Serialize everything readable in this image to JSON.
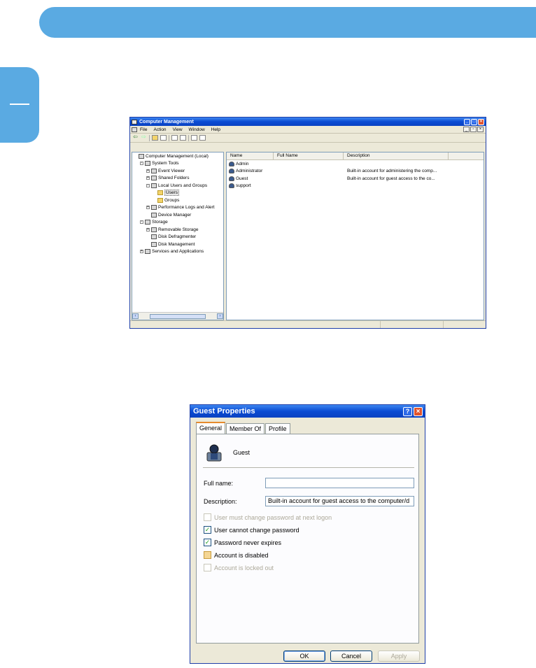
{
  "computer_management": {
    "title": "Computer Management",
    "menu": [
      "File",
      "Action",
      "View",
      "Window",
      "Help"
    ],
    "tree": [
      {
        "label": "Computer Management (Local)",
        "indent": 0,
        "icon": "computer-icon",
        "pm": ""
      },
      {
        "label": "System Tools",
        "indent": 1,
        "icon": "tools-icon",
        "pm": "−"
      },
      {
        "label": "Event Viewer",
        "indent": 2,
        "icon": "event-viewer-icon",
        "pm": "+"
      },
      {
        "label": "Shared Folders",
        "indent": 2,
        "icon": "shared-folders-icon",
        "pm": "+"
      },
      {
        "label": "Local Users and Groups",
        "indent": 2,
        "icon": "users-groups-icon",
        "pm": "−"
      },
      {
        "label": "Users",
        "indent": 3,
        "icon": "folder-icon",
        "pm": "",
        "selected": true
      },
      {
        "label": "Groups",
        "indent": 3,
        "icon": "folder-icon",
        "pm": ""
      },
      {
        "label": "Performance Logs and Alert",
        "indent": 2,
        "icon": "performance-icon",
        "pm": "+"
      },
      {
        "label": "Device Manager",
        "indent": 2,
        "icon": "device-manager-icon",
        "pm": ""
      },
      {
        "label": "Storage",
        "indent": 1,
        "icon": "storage-icon",
        "pm": "−"
      },
      {
        "label": "Removable Storage",
        "indent": 2,
        "icon": "removable-storage-icon",
        "pm": "+"
      },
      {
        "label": "Disk Defragmenter",
        "indent": 2,
        "icon": "defrag-icon",
        "pm": ""
      },
      {
        "label": "Disk Management",
        "indent": 2,
        "icon": "disk-management-icon",
        "pm": ""
      },
      {
        "label": "Services and Applications",
        "indent": 1,
        "icon": "services-icon",
        "pm": "+"
      }
    ],
    "columns": [
      "Name",
      "Full Name",
      "Description"
    ],
    "users": [
      {
        "name": "Admin",
        "full_name": "",
        "description": ""
      },
      {
        "name": "Administrator",
        "full_name": "",
        "description": "Built-in account for administering the comp..."
      },
      {
        "name": "Guest",
        "full_name": "",
        "description": "Built-in account for guest access to the co..."
      },
      {
        "name": "support",
        "full_name": "",
        "description": ""
      }
    ]
  },
  "guest_properties": {
    "title": "Guest Properties",
    "tabs": [
      "General",
      "Member Of",
      "Profile"
    ],
    "user_name": "Guest",
    "full_name_label": "Full name:",
    "full_name_value": "",
    "description_label": "Description:",
    "description_value": "Built-in account for guest access to the computer/d",
    "options": [
      {
        "label": "User must change password at next logon",
        "checked": false,
        "disabled": true
      },
      {
        "label": "User cannot change password",
        "checked": true,
        "disabled": false
      },
      {
        "label": "Password never expires",
        "checked": true,
        "disabled": false
      },
      {
        "label": "Account is disabled",
        "checked": false,
        "disabled": false,
        "highlight": true
      },
      {
        "label": "Account is locked out",
        "checked": false,
        "disabled": true
      }
    ],
    "buttons": {
      "ok": "OK",
      "cancel": "Cancel",
      "apply": "Apply"
    }
  }
}
